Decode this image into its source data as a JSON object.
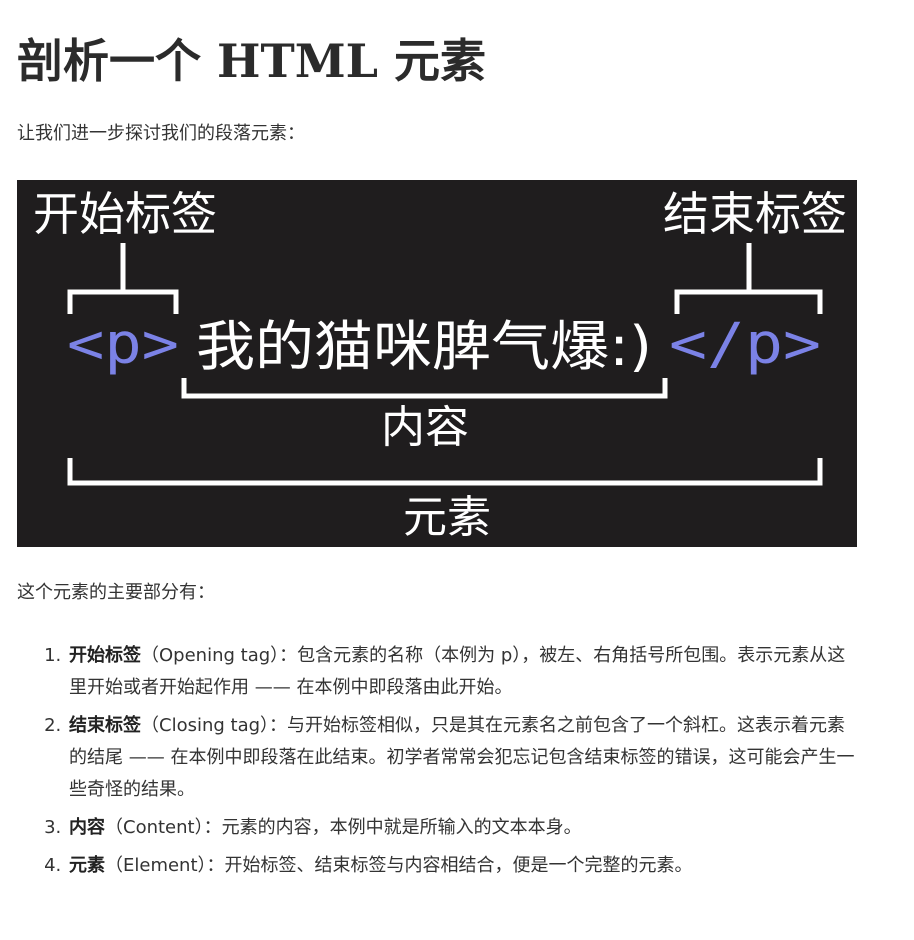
{
  "page": {
    "title": "剖析一个 HTML 元素",
    "intro": "让我们进一步探讨我们的段落元素："
  },
  "diagram": {
    "opening_tag_caption": "开始标签",
    "closing_tag_caption": "结束标签",
    "opening_tag": "<p>",
    "content_text": "我的猫咪脾气爆:)",
    "closing_tag": "</p>",
    "content_caption": "内容",
    "element_caption": "元素",
    "tag_color": "#7b82e6",
    "text_color": "#ffffff",
    "background": "#1f1d1e"
  },
  "summary": "这个元素的主要部分有：",
  "parts": [
    {
      "term": "开始标签",
      "description": "（Opening tag）：包含元素的名称（本例为 p），被左、右角括号所包围。表示元素从这里开始或者开始起作用 —— 在本例中即段落由此开始。"
    },
    {
      "term": "结束标签",
      "description": "（Closing tag）：与开始标签相似，只是其在元素名之前包含了一个斜杠。这表示着元素的结尾 —— 在本例中即段落在此结束。初学者常常会犯忘记包含结束标签的错误，这可能会产生一些奇怪的结果。"
    },
    {
      "term": "内容",
      "description": "（Content）：元素的内容，本例中就是所输入的文本本身。"
    },
    {
      "term": "元素",
      "description": "（Element）：开始标签、结束标签与内容相结合，便是一个完整的元素。"
    }
  ]
}
